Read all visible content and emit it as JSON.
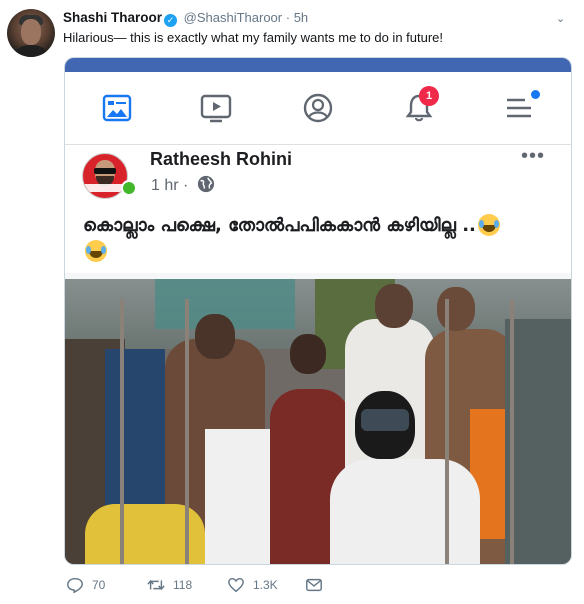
{
  "tweet": {
    "author_name": "Shashi Tharoor",
    "handle": "@ShashiTharoor",
    "separator": "·",
    "time": "5h",
    "verified_glyph": "✓",
    "caret_glyph": "⌄",
    "text": "Hilarious— this is exactly what my family wants me to do in future!"
  },
  "fb": {
    "accent": "#4267b2",
    "nav_icons": [
      "news-feed-icon",
      "watch-icon",
      "profile-icon",
      "notifications-icon",
      "menu-icon"
    ],
    "notification_count": "1",
    "post": {
      "author": "Ratheesh Rohini",
      "time": "1 hr ·",
      "more_glyph": "•••",
      "text": "കൊല്ലാം പക്ഷെ, തോൽപപികകാൻ കഴിയില്ല .."
    }
  },
  "actions": {
    "replies": "70",
    "retweets": "118",
    "likes": "1.3K"
  },
  "colors": {
    "twitter_blue": "#1da1f2",
    "meta_gray": "#657786",
    "badge_red": "#f02849",
    "online_green": "#42b72a"
  }
}
